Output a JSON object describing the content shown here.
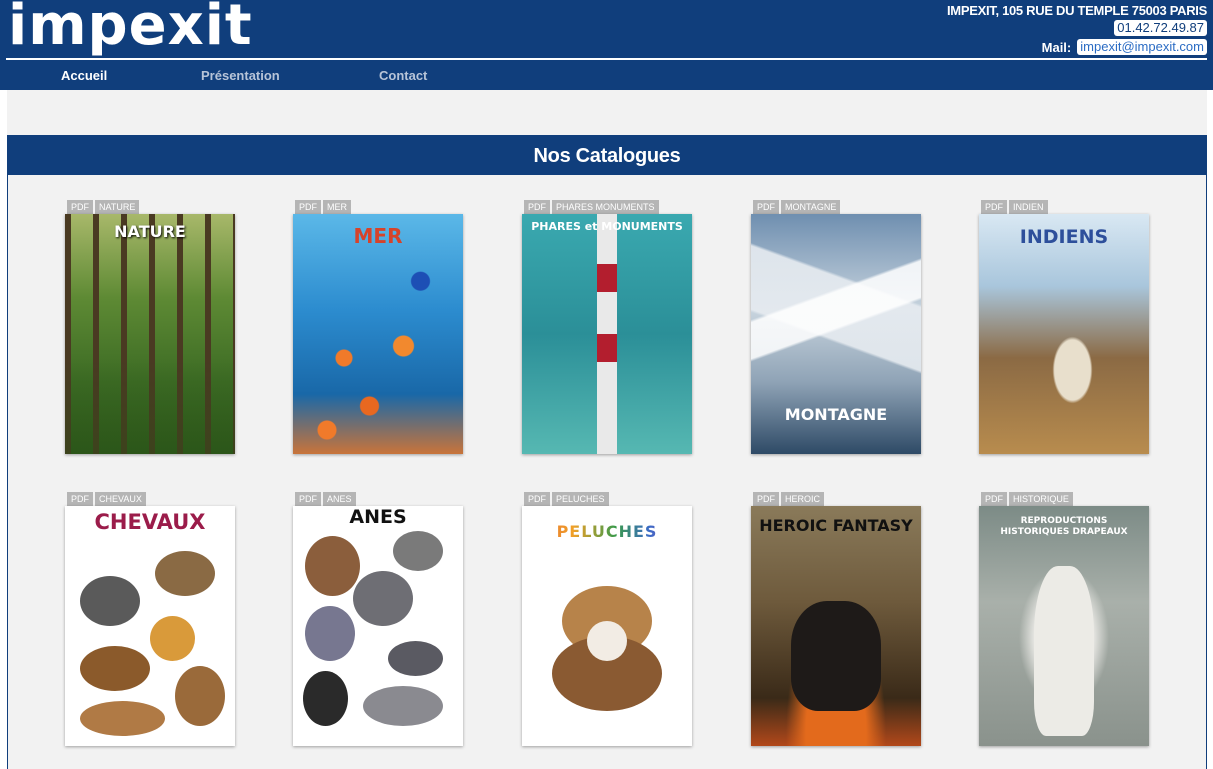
{
  "site": {
    "logo": "impexit",
    "address": "IMPEXIT, 105 RUE DU TEMPLE 75003 PARIS",
    "phone": "01.42.72.49.87",
    "mail_label": "Mail:",
    "mail": "impexit@impexit.com"
  },
  "nav": [
    {
      "label": "Accueil",
      "active": true
    },
    {
      "label": "Présentation",
      "active": false
    },
    {
      "label": "Contact",
      "active": false
    }
  ],
  "section": {
    "title": "Nos Catalogues"
  },
  "catalogues": [
    {
      "tag1": "PDF",
      "tag2": "NATURE",
      "cover_title": "NATURE"
    },
    {
      "tag1": "PDF",
      "tag2": "MER",
      "cover_title": "MER"
    },
    {
      "tag1": "PDF",
      "tag2": "PHARES MONUMENTS",
      "cover_title": "PHARES et MONUMENTS"
    },
    {
      "tag1": "PDF",
      "tag2": "MONTAGNE",
      "cover_title": "MONTAGNE"
    },
    {
      "tag1": "PDF",
      "tag2": "INDIEN",
      "cover_title": "INDIENS"
    },
    {
      "tag1": "PDF",
      "tag2": "CHEVAUX",
      "cover_title": "CHEVAUX"
    },
    {
      "tag1": "PDF",
      "tag2": "ANES",
      "cover_title": "ANES"
    },
    {
      "tag1": "PDF",
      "tag2": "PELUCHES",
      "cover_title": "PELUCHES"
    },
    {
      "tag1": "PDF",
      "tag2": "HEROIC",
      "cover_title": "HEROIC FANTASY"
    },
    {
      "tag1": "PDF",
      "tag2": "HISTORIQUE",
      "cover_title": "REPRODUCTIONS HISTORIQUES DRAPEAUX"
    }
  ],
  "colors": {
    "brand": "#103e7c",
    "background": "#f2f2f2",
    "tag": "#b5b5b5"
  }
}
